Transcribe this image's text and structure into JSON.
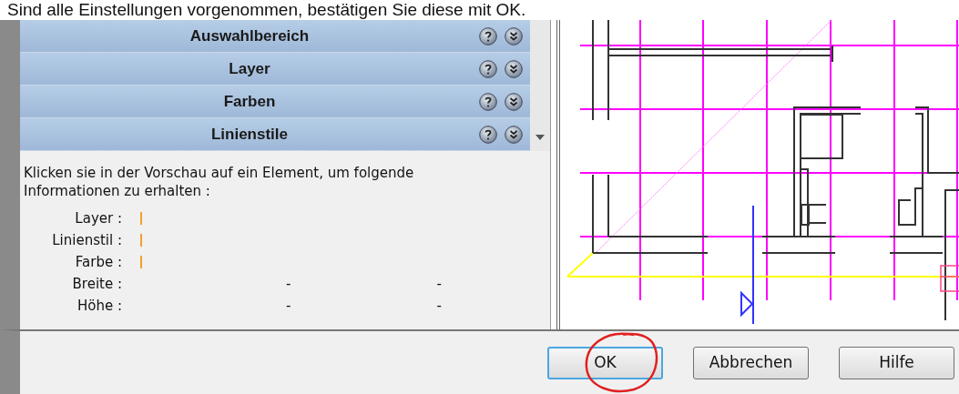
{
  "instruction": "Sind alle Einstellungen vorgenommen, bestätigen Sie diese mit OK.",
  "sections": [
    {
      "title": "Auswahlbereich"
    },
    {
      "title": "Layer"
    },
    {
      "title": "Farben"
    },
    {
      "title": "Linienstile"
    }
  ],
  "info": {
    "text": "Klicken sie in der Vorschau auf ein Element, um folgende Informationen zu erhalten :",
    "fields": [
      {
        "label": "Layer :",
        "kind": "marker"
      },
      {
        "label": "Linienstil :",
        "kind": "marker"
      },
      {
        "label": "Farbe :",
        "kind": "marker"
      },
      {
        "label": "Breite :",
        "kind": "dimension",
        "values": [
          "-",
          "-"
        ]
      },
      {
        "label": "Höhe :",
        "kind": "dimension",
        "values": [
          "-",
          "-"
        ]
      }
    ]
  },
  "buttons": [
    {
      "label": "OK",
      "selected": true
    },
    {
      "label": "Abbrechen",
      "selected": false
    },
    {
      "label": "Hilfe",
      "selected": false
    }
  ]
}
